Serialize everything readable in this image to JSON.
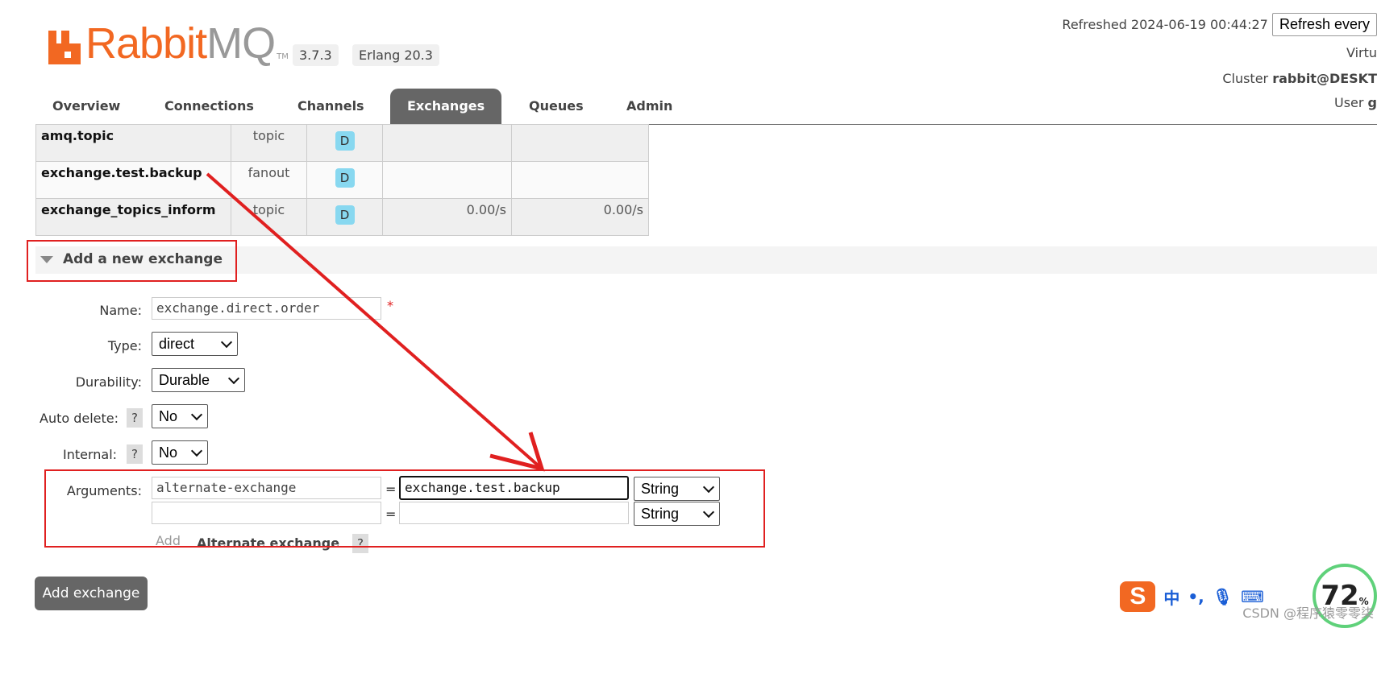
{
  "header": {
    "logo_text_rabbit": "Rabbit",
    "logo_text_mq": "MQ",
    "logo_tm": "TM",
    "version": "3.7.3",
    "erlang": "Erlang 20.3",
    "refreshed_label": "Refreshed 2024-06-19 00:44:27",
    "refresh_select": "Refresh every",
    "virtual_host_label": "Virtu",
    "cluster_label": "Cluster",
    "cluster_value": "rabbit@DESKT",
    "user_label": "User",
    "user_value": "g"
  },
  "tabs": [
    {
      "label": "Overview"
    },
    {
      "label": "Connections"
    },
    {
      "label": "Channels"
    },
    {
      "label": "Exchanges",
      "active": true
    },
    {
      "label": "Queues"
    },
    {
      "label": "Admin"
    }
  ],
  "exchanges": [
    {
      "name": "amq.topic",
      "type": "topic",
      "features": "D",
      "rate_in": "",
      "rate_out": ""
    },
    {
      "name": "exchange.test.backup",
      "type": "fanout",
      "features": "D",
      "rate_in": "",
      "rate_out": ""
    },
    {
      "name": "exchange_topics_inform",
      "type": "topic",
      "features": "D",
      "rate_in": "0.00/s",
      "rate_out": "0.00/s"
    }
  ],
  "add_exchange": {
    "section_title": "Add a new exchange",
    "name_label": "Name:",
    "name_value": "exchange.direct.order",
    "required_mark": "*",
    "type_label": "Type:",
    "type_value": "direct",
    "durability_label": "Durability:",
    "durability_value": "Durable",
    "auto_delete_label": "Auto delete:",
    "auto_delete_value": "No",
    "internal_label": "Internal:",
    "internal_value": "No",
    "help": "?",
    "arguments_label": "Arguments:",
    "arg1_key": "alternate-exchange",
    "arg1_value": "exchange.test.backup",
    "arg1_type": "String",
    "arg2_key": "",
    "arg2_value": "",
    "arg2_type": "String",
    "equals": "=",
    "add_link": "Add",
    "alternate_exchange_link": "Alternate exchange",
    "submit": "Add exchange"
  },
  "ime": {
    "logo": "S",
    "lang": "中",
    "punct": "•,",
    "mic": "🎙",
    "keyboard": "⌨",
    "gauge": "72",
    "gauge_unit": "%"
  },
  "watermark": "CSDN @程序猿零零柒",
  "colors": {
    "brand": "#f26822",
    "tab_active": "#666666",
    "annotation": "#e02020",
    "feature_badge": "#88d8f0"
  }
}
